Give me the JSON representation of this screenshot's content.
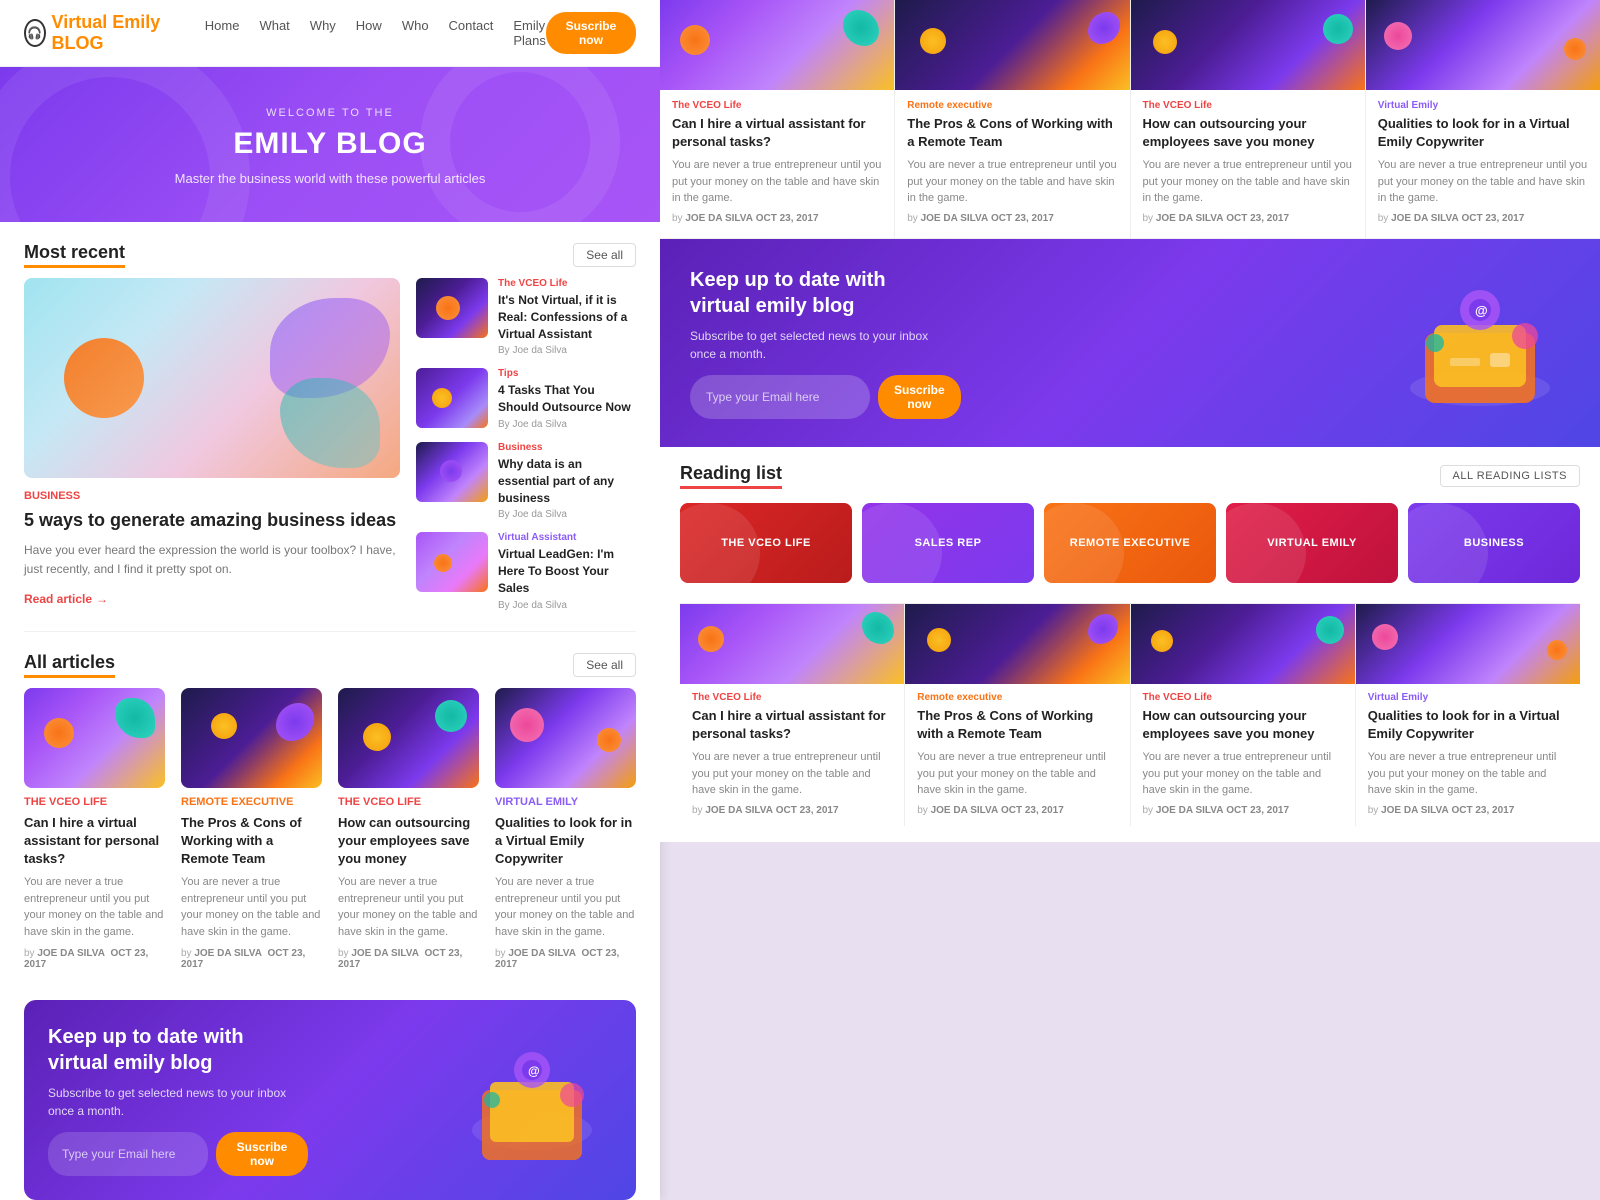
{
  "site": {
    "logo_text": "Virtual Emily",
    "logo_highlight": "BLOG",
    "nav_links": [
      "Home",
      "What",
      "Why",
      "How",
      "Who",
      "Contact",
      "Emily Plans"
    ],
    "nav_subscribe": "Suscribe now"
  },
  "hero": {
    "welcome": "WELCOME TO THE",
    "title": "EMILY BLOG",
    "subtitle": "Master the business world with these powerful articles"
  },
  "most_recent": {
    "label": "Most recent",
    "see_all": "See all",
    "featured": {
      "category": "Business",
      "title": "5 ways to generate amazing business ideas",
      "excerpt": "Have you ever heard the expression the world is your toolbox? I have, just recently, and I find it pretty spot on.",
      "read_more": "Read article"
    },
    "side_articles": [
      {
        "category": "The VCEO Life",
        "title": "It's Not Virtual, if it is Real: Confessions of a Virtual Assistant",
        "author": "By Joe da Silva"
      },
      {
        "category": "Tips",
        "title": "4 Tasks That You Should Outsource Now",
        "author": "By Joe da Silva"
      },
      {
        "category": "Business",
        "title": "Why data is an essential part of any business",
        "author": "By Joe da Silva"
      },
      {
        "category": "Virtual Assistant",
        "title": "Virtual LeadGen: I'm Here To Boost Your Sales",
        "author": "By Joe da Silva"
      }
    ]
  },
  "all_articles": {
    "label": "All articles",
    "see_all": "See all",
    "articles": [
      {
        "category": "The VCEO Life",
        "title": "Can I hire a virtual assistant for personal tasks?",
        "excerpt": "You are never a true entrepreneur until you put your money on the table and have skin in the game.",
        "author": "JOE DA SILVA",
        "date": "OCT 23, 2017"
      },
      {
        "category": "Remote executive",
        "title": "The Pros & Cons of Working with a Remote Team",
        "excerpt": "You are never a true entrepreneur until you put your money on the table and have skin in the game.",
        "author": "JOE DA SILVA",
        "date": "OCT 23, 2017"
      },
      {
        "category": "The VCEO Life",
        "title": "How can outsourcing your employees save you money",
        "excerpt": "You are never a true entrepreneur until you put your money on the table and have skin in the game.",
        "author": "JOE DA SILVA",
        "date": "OCT 23, 2017"
      },
      {
        "category": "Virtual Emily",
        "title": "Qualities to look for in a Virtual Emily Copywriter",
        "excerpt": "You are never a true entrepreneur until you put your money on the table and have skin in the game.",
        "author": "JOE DA SILVA",
        "date": "OCT 23, 2017"
      }
    ]
  },
  "newsletter": {
    "title": "Keep up to date with virtual emily blog",
    "subtitle": "Subscribe to get selected news to your inbox once a month.",
    "input_placeholder": "Type your Email here",
    "button": "Suscribe now"
  },
  "reading_list": {
    "label": "Reading list",
    "all_lists": "ALL READING LISTS",
    "categories": [
      {
        "label": "THE VCEO LIFE",
        "class": "cat-vceo"
      },
      {
        "label": "SALES REP",
        "class": "cat-sales"
      },
      {
        "label": "REMOTE EXECUTIVE",
        "class": "cat-remote"
      },
      {
        "label": "VIRTUAL EMILY",
        "class": "cat-virtual"
      },
      {
        "label": "BUSINESS",
        "class": "cat-business"
      }
    ]
  },
  "right_top_cards": [
    {
      "category": "The VCEO Life",
      "category_class": "category-vceo",
      "title": "Can I hire a virtual assistant for personal tasks?",
      "excerpt": "You are never a true entrepreneur until you put your money on the table and have skin in the game.",
      "author": "JOE DA SILVA",
      "date": "OCT 23, 2017"
    },
    {
      "category": "Remote executive",
      "category_class": "category-remote",
      "title": "The Pros & Cons of Working with a Remote Team",
      "excerpt": "You are never a true entrepreneur until you put your money on the table and have skin in the game.",
      "author": "JOE DA SILVA",
      "date": "OCT 23, 2017"
    },
    {
      "category": "The VCEO Life",
      "category_class": "category-vceo",
      "title": "How can outsourcing your employees save you money",
      "excerpt": "You are never a true entrepreneur until you put your money on the table and have skin in the game.",
      "author": "JOE DA SILVA",
      "date": "OCT 23, 2017"
    },
    {
      "category": "Virtual Emily",
      "category_class": "category-virtual",
      "title": "Qualities to look for in a Virtual Emily Copywriter",
      "excerpt": "You are never a true entrepreneur until you put your money on the table and have skin in the game.",
      "author": "JOE DA SILVA",
      "date": "OCT 23, 2017"
    }
  ],
  "right_bottom_cards": [
    {
      "category": "The VCEO Life",
      "category_class": "category-vceo",
      "title": "Can I hire a virtual assistant for personal tasks?",
      "excerpt": "You are never a true entrepreneur until you put your money on the table and have skin in the game.",
      "author": "JOE DA SILVA",
      "date": "OCT 23, 2017"
    },
    {
      "category": "Remote executive",
      "category_class": "category-remote",
      "title": "The Pros & Cons of Working with a Remote Team",
      "excerpt": "You are never a true entrepreneur until you put your money on the table and have skin in the game.",
      "author": "JOE DA SILVA",
      "date": "OCT 23, 2017"
    },
    {
      "category": "The VCEO Life",
      "category_class": "category-vceo",
      "title": "How can outsourcing your employees save you money",
      "excerpt": "You are never a true entrepreneur until you put your money on the table and have skin in the game.",
      "author": "JOE DA SILVA",
      "date": "OCT 23, 2017"
    },
    {
      "category": "Virtual Emily",
      "category_class": "category-virtual",
      "title": "Qualities to look for in a Virtual Emily Copywriter",
      "excerpt": "You are never a true entrepreneur until you put your money on the table and have skin in the game.",
      "author": "JOE DA SILVA",
      "date": "OCT 23, 2017"
    }
  ]
}
